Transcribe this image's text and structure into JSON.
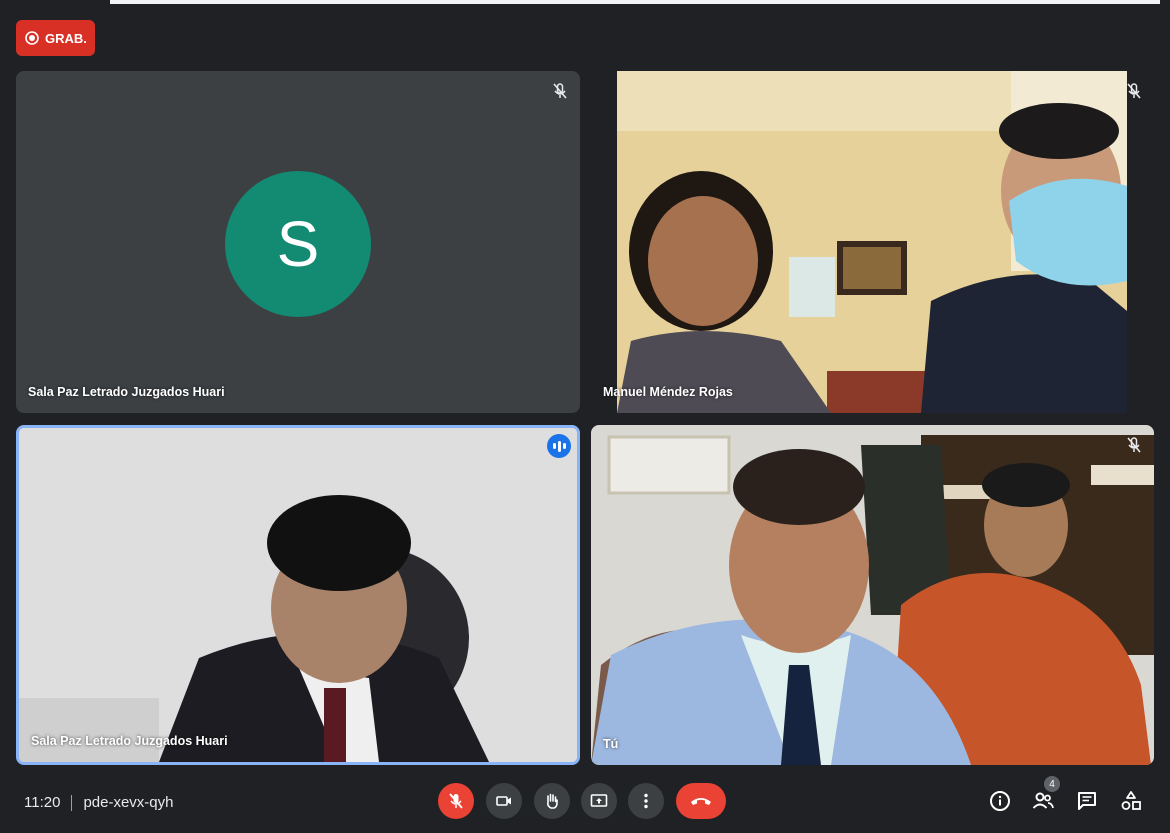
{
  "recording": {
    "label": "GRAB."
  },
  "participants": [
    {
      "name": "Sala Paz Letrado Juzgados Huari",
      "initial": "S"
    },
    {
      "name": "Manuel Méndez Rojas"
    },
    {
      "name": "Sala Paz Letrado Juzgados Huari"
    },
    {
      "name": "Tú"
    }
  ],
  "meeting": {
    "time": "11:20",
    "code": "pde-xevx-qyh"
  },
  "people_count": "4",
  "icons": {
    "mic_muted": "mic-off-icon",
    "camera": "videocam-icon",
    "raise_hand": "hand-icon",
    "present": "present-screen-icon",
    "more": "more-vert-icon",
    "hangup": "call-end-icon",
    "info": "info-icon",
    "people": "people-icon",
    "chat": "chat-icon",
    "activities": "activities-icon"
  },
  "colors": {
    "background": "#202124",
    "tile": "#3c4043",
    "avatar": "#138a72",
    "danger": "#ea4335",
    "active_border": "#8ab4f8"
  }
}
